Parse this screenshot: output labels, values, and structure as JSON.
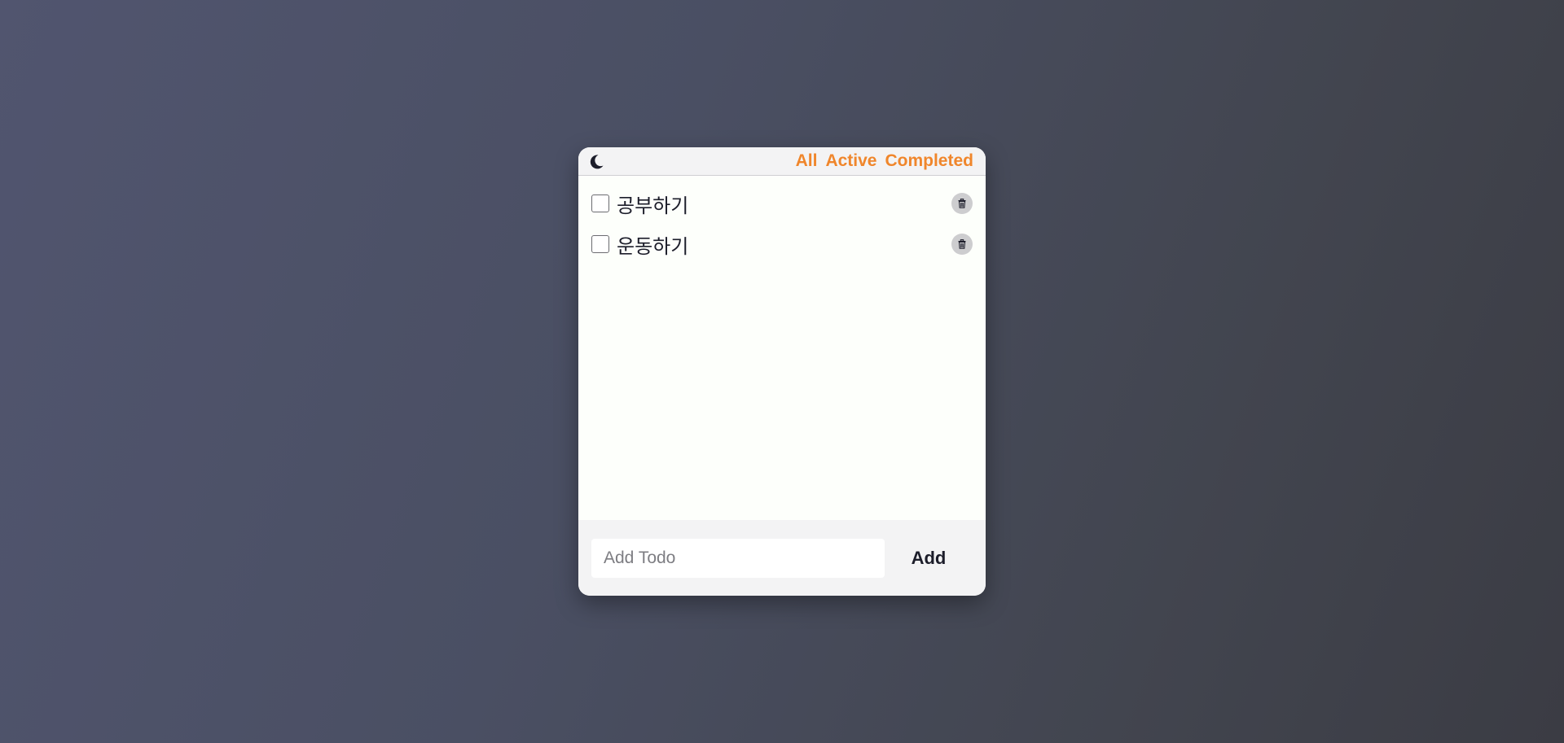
{
  "header": {
    "theme_toggle_icon": "moon-icon",
    "filters": [
      {
        "label": "All"
      },
      {
        "label": "Active"
      },
      {
        "label": "Completed"
      }
    ]
  },
  "todos": [
    {
      "text": "공부하기",
      "completed": false,
      "delete_icon": "trash-icon"
    },
    {
      "text": "운동하기",
      "completed": false,
      "delete_icon": "trash-icon"
    }
  ],
  "footer": {
    "input_value": "",
    "input_placeholder": "Add Todo",
    "add_label": "Add"
  },
  "colors": {
    "accent": "#f0862b",
    "text": "#1c1d2a",
    "header_bg": "#f3f3f4",
    "list_bg": "#fdfffb"
  }
}
